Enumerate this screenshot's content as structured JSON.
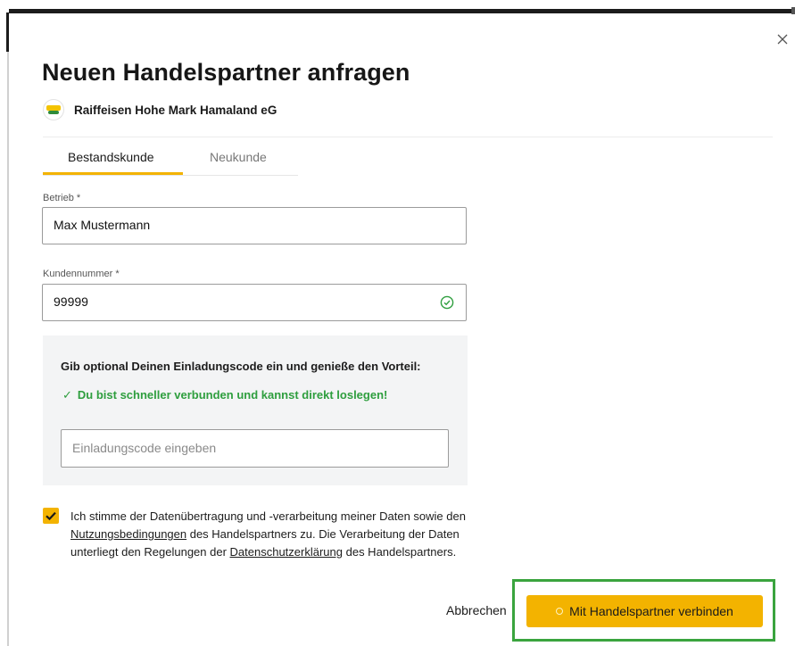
{
  "dialog": {
    "title": "Neuen Handelspartner anfragen",
    "partner_name": "Raiffeisen Hohe Mark Hamaland eG",
    "close_icon": "close-icon"
  },
  "tabs": [
    {
      "label": "Bestandskunde",
      "active": true
    },
    {
      "label": "Neukunde",
      "active": false
    }
  ],
  "form": {
    "betrieb_label": "Betrieb *",
    "betrieb_value": "Max Mustermann",
    "kundennummer_label": "Kundennummer *",
    "kundennummer_value": "99999",
    "kundennummer_status_icon": "check-circle-icon"
  },
  "invite": {
    "title": "Gib optional Deinen Einladungscode ein und genieße den Vorteil:",
    "benefit_check": "✓",
    "benefit": "Du bist schneller verbunden und kannst direkt loslegen!",
    "placeholder": "Einladungscode eingeben",
    "value": ""
  },
  "consent": {
    "checked": true,
    "text_1": "Ich stimme der Datenübertragung und -verarbeitung meiner Daten sowie den ",
    "link_1": "Nutzungsbedingungen",
    "text_2": " des Handelspartners zu. Die Verarbeitung der Daten unterliegt den Regelungen der ",
    "link_2": "Datenschutzerklärung",
    "text_3": " des Handelspartners."
  },
  "actions": {
    "cancel": "Abbrechen",
    "submit": "Mit Handelspartner verbinden"
  },
  "colors": {
    "accent": "#f3b300",
    "success": "#2e9e3e",
    "highlight_frame": "#3aa43e",
    "panel_bg": "#f3f4f5"
  }
}
